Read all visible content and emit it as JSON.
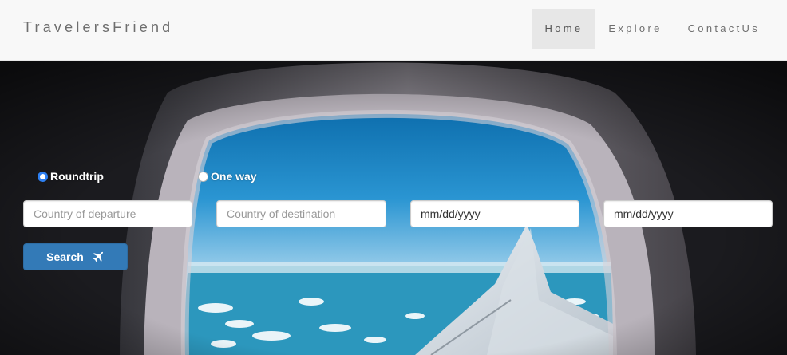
{
  "navbar": {
    "brand": "TravelersFriend",
    "items": [
      {
        "label": "Home",
        "active": true
      },
      {
        "label": "Explore",
        "active": false
      },
      {
        "label": "ContactUs",
        "active": false
      }
    ]
  },
  "trip_type": {
    "options": [
      {
        "label": "Roundtrip",
        "checked": true
      },
      {
        "label": "One way",
        "checked": false
      }
    ]
  },
  "form": {
    "departure_placeholder": "Country of departure",
    "destination_placeholder": "Country of destination",
    "depart_date_value": "mm/dd/yyyy",
    "return_date_value": "mm/dd/yyyy",
    "search_label": "Search",
    "search_icon": "plane-icon"
  },
  "colors": {
    "navbar_bg": "#f8f8f8",
    "active_nav_bg": "#e7e7e7",
    "button_primary": "#337ab7",
    "radio_checked": "#2d7ff1"
  }
}
